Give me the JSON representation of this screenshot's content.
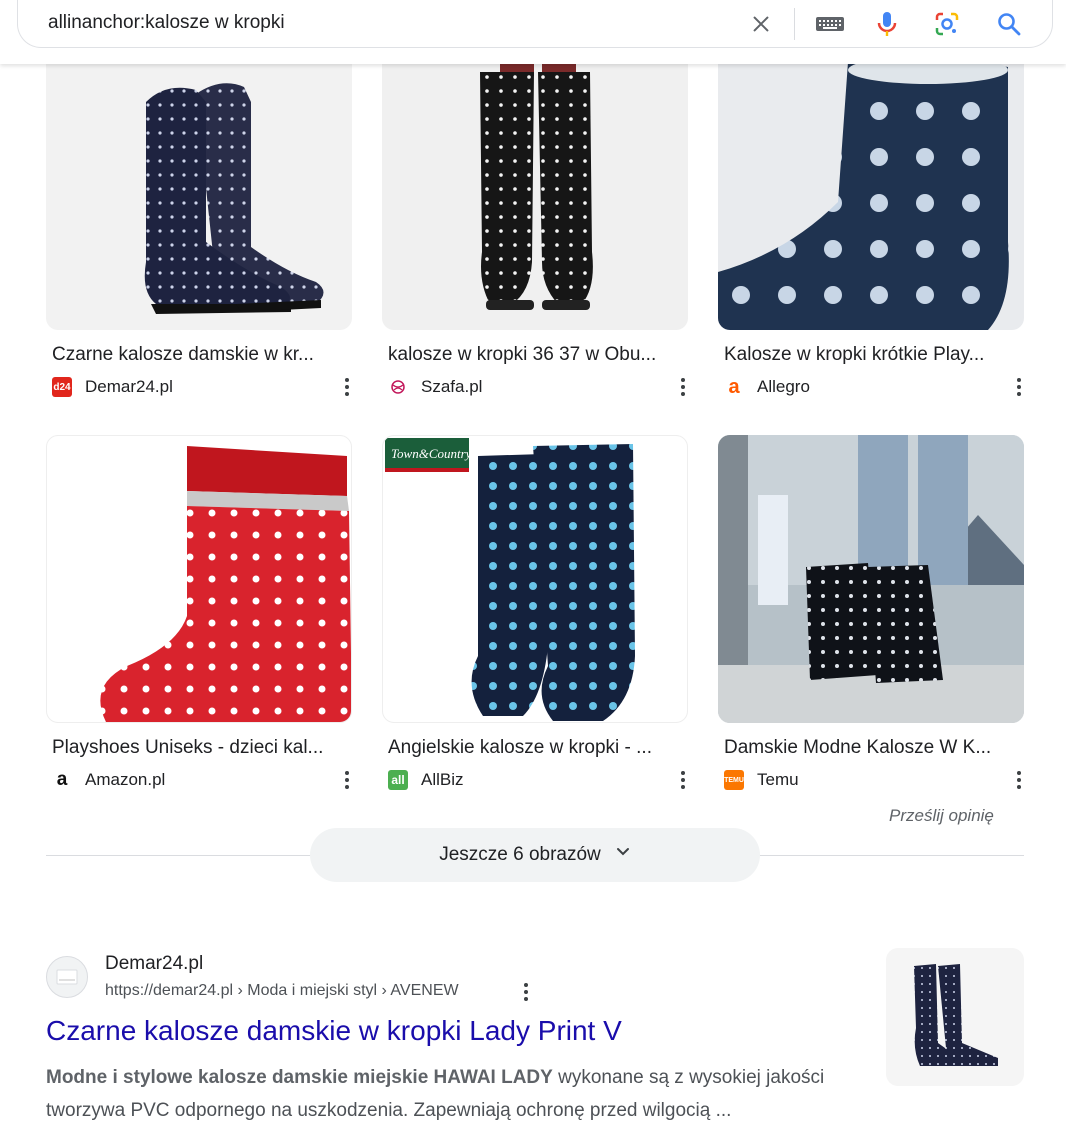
{
  "search": {
    "query": "allinanchor:kalosze w kropki",
    "icons": [
      "close-icon",
      "keyboard-icon",
      "mic-icon",
      "lens-icon",
      "search-icon"
    ]
  },
  "images": [
    {
      "title": "Czarne kalosze damskie w kr...",
      "source": "Demar24.pl",
      "favicon_text": "d24",
      "favicon_color": "#e1261c"
    },
    {
      "title": "kalosze w kropki 36 37 w Obu...",
      "source": "Szafa.pl",
      "favicon_text": "",
      "favicon_color": "#ffffff"
    },
    {
      "title": "Kalosze w kropki krótkie Play...",
      "source": "Allegro",
      "favicon_text": "a",
      "favicon_color": "#ff5a00"
    },
    {
      "title": "Playshoes Uniseks - dzieci kal...",
      "source": "Amazon.pl",
      "favicon_text": "a",
      "favicon_color": "#ffffff"
    },
    {
      "title": "Angielskie kalosze w kropki - ...",
      "source": "AllBiz",
      "favicon_text": "all",
      "favicon_color": "#4caf50"
    },
    {
      "title": "Damskie Modne Kalosze W K...",
      "source": "Temu",
      "favicon_text": "TEMU",
      "favicon_color": "#fb7701"
    }
  ],
  "overlay_text": {
    "town_country": "Town&Country"
  },
  "feedback_label": "Prześlij opinię",
  "more_images_label": "Jeszcze 6 obrazów",
  "result": {
    "site": "Demar24.pl",
    "url": "https://demar24.pl › Moda i miejski styl › AVENEW",
    "title": "Czarne kalosze damskie w kropki Lady Print V",
    "snippet_bold": "Modne i stylowe kalosze damskie miejskie HAWAI LADY",
    "snippet_rest": " wykonane są z wysokiej jakości tworzywa PVC odpornego na uszkodzenia. Zapewniają ochronę przed wilgocią ..."
  },
  "colors": {
    "link": "#1a0dab",
    "google_blue": "#4285f4",
    "google_red": "#ea4335",
    "google_yellow": "#fbbc05",
    "google_green": "#34a853"
  }
}
